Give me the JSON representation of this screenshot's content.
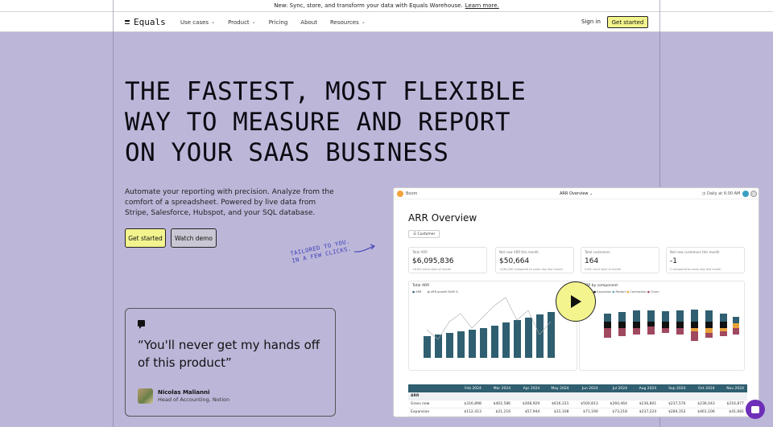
{
  "banner": {
    "text": "New: Sync, store, and transform your data with Equals Warehouse.",
    "link": "Learn more."
  },
  "nav": {
    "logo": "Equals",
    "items": [
      {
        "label": "Use cases",
        "caret": true
      },
      {
        "label": "Product",
        "caret": true
      },
      {
        "label": "Pricing",
        "caret": false
      },
      {
        "label": "About",
        "caret": false
      },
      {
        "label": "Resources",
        "caret": true
      }
    ],
    "signin": "Sign in",
    "cta": "Get started"
  },
  "hero": {
    "title_lines": [
      "THE FASTEST, MOST FLEXIBLE",
      "WAY TO MEASURE AND REPORT",
      "ON YOUR SAAS BUSINESS"
    ],
    "subtitle": "Automate your reporting with precision. Analyze from the comfort of a spreadsheet. Powered by live data from Stripe, Salesforce, Hubspot, and your SQL database.",
    "primary": "Get started",
    "secondary": "Watch demo",
    "tailored_lines": [
      "TAILORED TO YOU.",
      "IN A FEW CLICKS."
    ]
  },
  "quote": {
    "text": "“You'll never get my hands off of this product”",
    "name": "Nicolas Malianni",
    "role": "Head of Accounting, Notion"
  },
  "dashboard": {
    "brand": "Boom",
    "doc": "ARR Overview",
    "daily": "Daily at 6:00 AM",
    "title": "ARR Overview",
    "filter": "Customer",
    "kpis": [
      {
        "label": "Total ARR",
        "value": "$6,095,836",
        "note": "+6.8% since start of month"
      },
      {
        "label": "Net new ARR this month",
        "value": "$50,664",
        "note": "+$36,290 compared to same day last month"
      },
      {
        "label": "Total customers",
        "value": "164",
        "note": "0.6% since start of month"
      },
      {
        "label": "Net new customers this month",
        "value": "-1",
        "note": "2 compared to same day last month"
      }
    ],
    "chart_left_title": "Total ARR",
    "chart_left_legend": [
      "ARR",
      "ARR growth MoM %"
    ],
    "chart_right_title": "ARR by component",
    "chart_right_legend": [
      "New",
      "Expansion",
      "Restart",
      "Contraction",
      "Churn"
    ],
    "table": {
      "headers": [
        "",
        "Feb 2024",
        "Mar 2024",
        "Apr 2024",
        "May 2024",
        "Jun 2024",
        "Jul 2024",
        "Aug 2024",
        "Sep 2024",
        "Oct 2024",
        "Nov 2024"
      ],
      "section": "ARR",
      "rows": [
        [
          "Gross new",
          "$316,898",
          "$402,586",
          "$308,929",
          "$616,331",
          "$500,813",
          "$260,464",
          "$236,801",
          "$237,576",
          "$236,043",
          "$216,877"
        ],
        [
          "Expansion",
          "$112,413",
          "$21,216",
          "$57,944",
          "$31,108",
          "$71,190",
          "$73,218",
          "$237,224",
          "$284,352",
          "$461,106",
          "$41,681"
        ]
      ]
    }
  },
  "colors": {
    "accent": "#f3f48e",
    "hero_bg": "#bcb7d9",
    "bar": "#2f5f70",
    "churn": "#a0485e",
    "contraction": "#e8a23a",
    "chat": "#6e2fb8"
  }
}
